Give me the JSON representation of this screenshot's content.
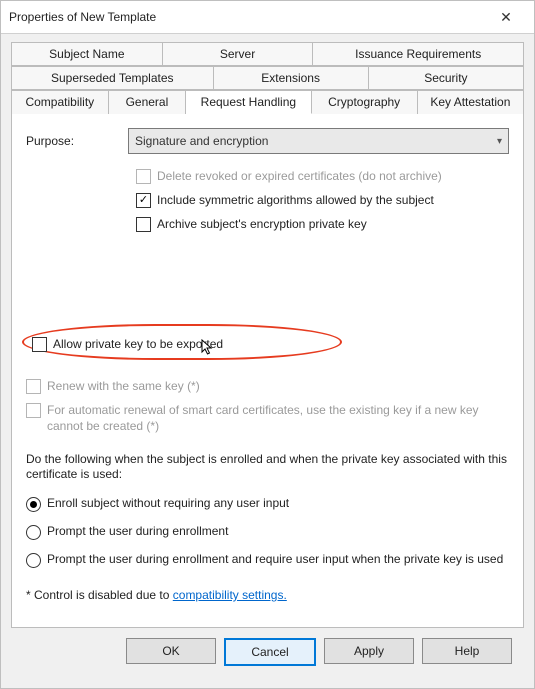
{
  "window": {
    "title": "Properties of New Template"
  },
  "tabs": {
    "row1": [
      "Subject Name",
      "Server",
      "Issuance Requirements"
    ],
    "row2": [
      "Superseded Templates",
      "Extensions",
      "Security"
    ],
    "row3": [
      "Compatibility",
      "General",
      "Request Handling",
      "Cryptography",
      "Key Attestation"
    ],
    "active": "Request Handling"
  },
  "purpose": {
    "label": "Purpose:",
    "value": "Signature and encryption"
  },
  "topchecks": {
    "delete_revoked": "Delete revoked or expired certificates (do not archive)",
    "include_sym": "Include symmetric algorithms allowed by the subject",
    "archive_key": "Archive subject's encryption private key"
  },
  "allow_export": "Allow private key to be exported",
  "renew_same": "Renew with the same key (*)",
  "auto_renew": "For automatic renewal of smart card certificates, use the existing key if a new key cannot be created (*)",
  "enroll_intro": "Do the following when the subject is enrolled and when the private key associated with this certificate is used:",
  "radios": {
    "r1": "Enroll subject without requiring any user input",
    "r2": "Prompt the user during enrollment",
    "r3": "Prompt the user during enrollment and require user input when the private key is used"
  },
  "footnote_prefix": "* Control is disabled due to ",
  "footnote_link": "compatibility settings.",
  "buttons": {
    "ok": "OK",
    "cancel": "Cancel",
    "apply": "Apply",
    "help": "Help"
  }
}
